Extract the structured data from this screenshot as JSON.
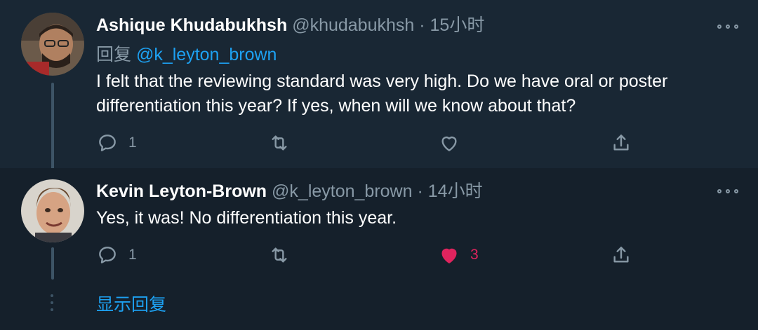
{
  "tweets": [
    {
      "name": "Ashique Khudabukhsh",
      "handle": "@khudabukhsh",
      "separator": "·",
      "time": "15小时",
      "reply_label": "回复",
      "reply_to": "@k_leyton_brown",
      "text": "I felt that the reviewing standard was very high. Do we have oral or poster differentiation this year? If yes, when will we know about that?",
      "reply_count": "1",
      "retweet_count": "",
      "like_count": "",
      "liked": false
    },
    {
      "name": "Kevin Leyton-Brown",
      "handle": "@k_leyton_brown",
      "separator": "·",
      "time": "14小时",
      "text": "Yes, it was! No differentiation this year.",
      "reply_count": "1",
      "retweet_count": "",
      "like_count": "3",
      "liked": true
    }
  ],
  "show_replies_label": "显示回复",
  "colors": {
    "background": "#15202b",
    "highlight_background": "#192734",
    "secondary_text": "#8899a6",
    "link": "#1da1f2",
    "like": "#e0245e"
  },
  "icons": [
    "reply-icon",
    "retweet-icon",
    "like-icon",
    "share-icon",
    "more-icon"
  ]
}
